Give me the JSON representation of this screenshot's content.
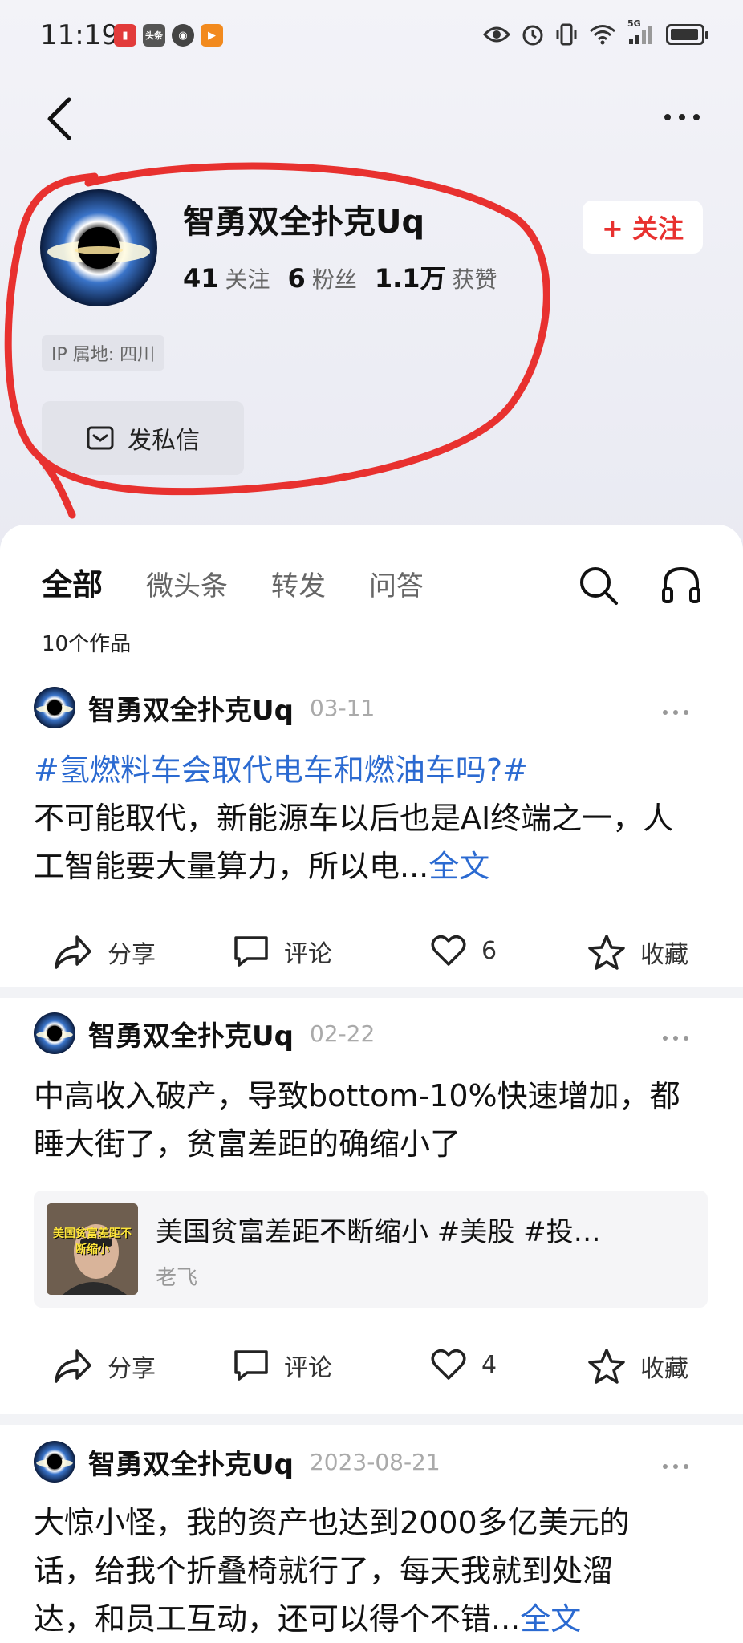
{
  "status_bar": {
    "time": "11:19",
    "app_icons": [
      "book-app-icon",
      "toutiao-app-icon",
      "podcast-app-icon",
      "video-app-icon"
    ],
    "toutiao_label": "头条",
    "network": "5G"
  },
  "header": {
    "back_icon": "chevron-left-icon",
    "more_icon": "more-dots-icon"
  },
  "profile": {
    "name": "智勇双全扑克Uq",
    "follow_button": "+ 关注",
    "stats": [
      {
        "value": "41",
        "label": "关注"
      },
      {
        "value": "6",
        "label": "粉丝"
      },
      {
        "value": "1.1万",
        "label": "获赞"
      }
    ],
    "ip_location": "IP 属地: 四川",
    "dm_button": "发私信",
    "highlight_color": "#e8312f"
  },
  "tabs": {
    "items": [
      "全部",
      "微头条",
      "转发",
      "问答"
    ],
    "active": "全部"
  },
  "works_count": "10个作品",
  "posts": [
    {
      "author": "智勇双全扑克Uq",
      "date": "03-11",
      "hashtag": "#氢燃料车会取代电车和燃油车吗?#",
      "text": "不可能取代，新能源车以后也是AI终端之一，人工智能要大量算力，所以电...",
      "fulltext_link": "全文",
      "actions": {
        "share": "分享",
        "comment": "评论",
        "likes": "6",
        "collect": "收藏"
      }
    },
    {
      "author": "智勇双全扑克Uq",
      "date": "02-22",
      "text": "中高收入破产，导致bottom-10%快速增加，都睡大街了，贫富差距的确缩小了",
      "embed": {
        "thumb_text": "美国贫富差距不断缩小",
        "title": "美国贫富差距不断缩小 #美股 #投…",
        "author": "老飞"
      },
      "actions": {
        "share": "分享",
        "comment": "评论",
        "likes": "4",
        "collect": "收藏"
      }
    },
    {
      "author": "智勇双全扑克Uq",
      "date": "2023-08-21",
      "text_line1": "大惊小怪，我的资产也达到2000多亿美元的",
      "text_line2": "话，给我个折叠椅就行了，每天我就到处溜",
      "text_line3": "达，和员工互动，还可以得个不错...",
      "fulltext_link": "全文"
    }
  ]
}
